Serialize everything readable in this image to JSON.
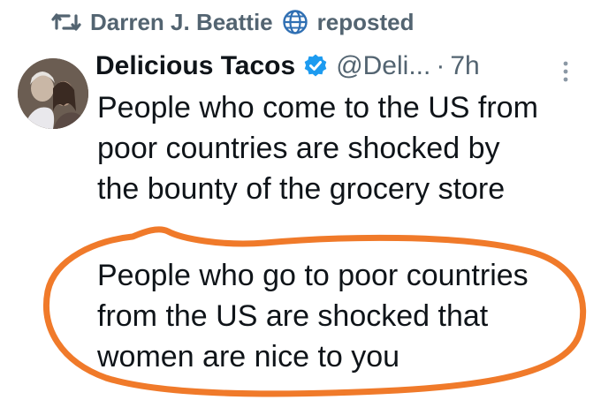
{
  "repost": {
    "user": "Darren J. Beattie",
    "action": "reposted"
  },
  "tweet": {
    "name": "Delicious Tacos",
    "handle": "@Deli...",
    "separator": "·",
    "time": "7h",
    "paragraph1": [
      "People who come to the US from",
      "poor countries are shocked by",
      "the bounty of the grocery store"
    ],
    "paragraph2": [
      "People who go to poor countries",
      "from the US are shocked that",
      "women are nice to you"
    ]
  },
  "icons": {
    "repost": "repost-icon",
    "globe": "globe-icon",
    "verified": "verified-icon",
    "more": "more-icon"
  },
  "colors": {
    "secondary_text": "#536471",
    "verified_blue": "#1d9bf0",
    "annotation_orange": "#f07a2a"
  }
}
